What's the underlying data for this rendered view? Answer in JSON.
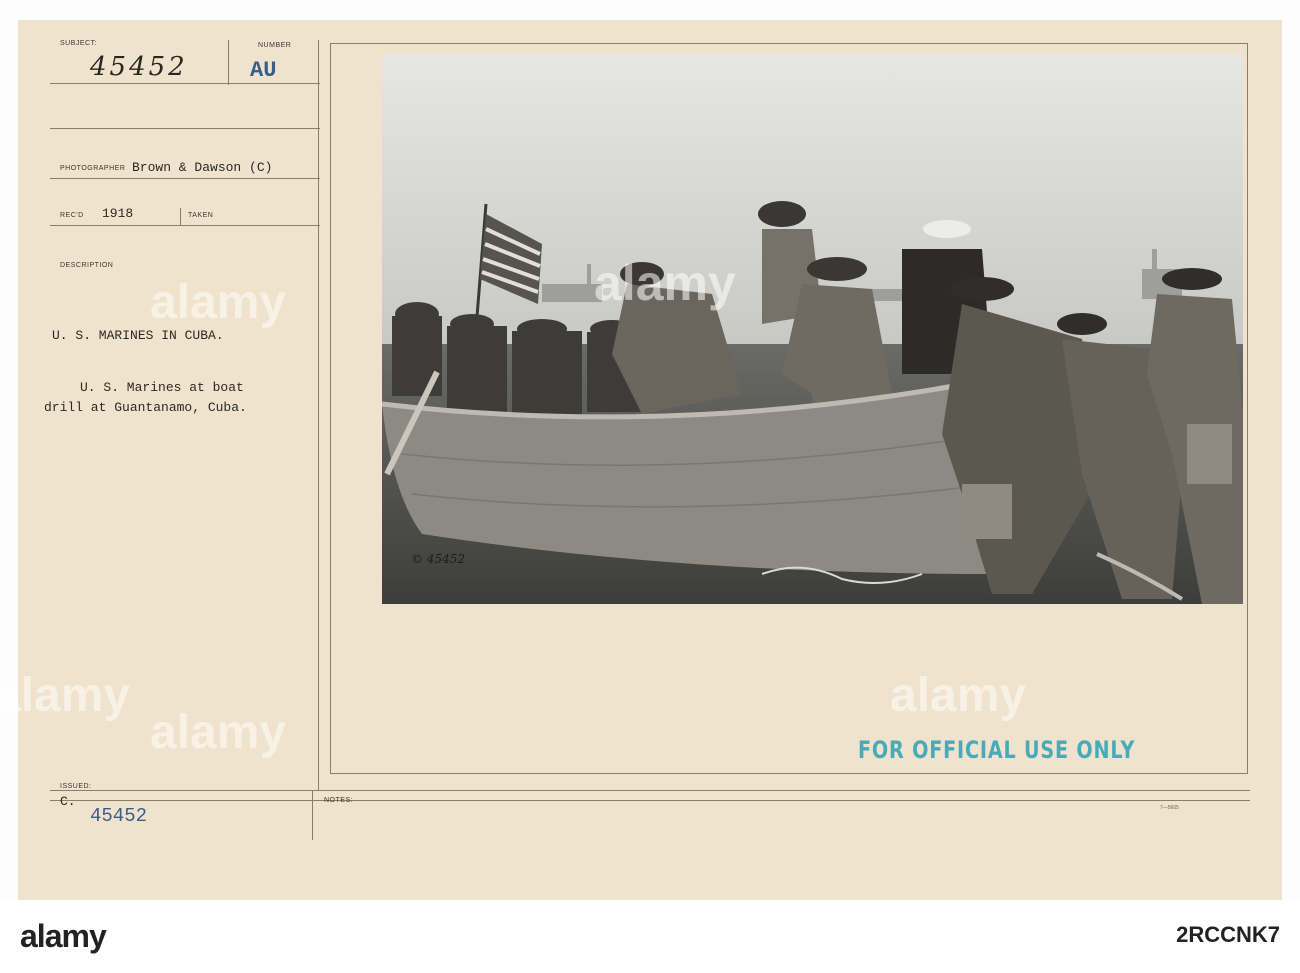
{
  "card": {
    "subject_label": "SUBJECT:",
    "subject_value": "45452",
    "number_label": "NUMBER",
    "number_value": "AU",
    "photographer_label": "PHOTOGRAPHER",
    "photographer_value": "Brown & Dawson (C)",
    "recd_label": "REC'D",
    "recd_value": "1918",
    "taken_label": "TAKEN",
    "description_label": "DESCRIPTION",
    "description_title": "U. S. MARINES IN CUBA.",
    "description_line1": "U. S. Marines at boat",
    "description_line2": "drill at Guantanamo, Cuba.",
    "issued_label": "ISSUED:",
    "issued_prefix": "C.",
    "issued_value": "45452",
    "notes_label": "NOTES:",
    "form_code": "7—5605",
    "stamp_text": "FOR OFFICIAL USE ONLY",
    "negative_number": "© 45452"
  },
  "watermark": {
    "text": "alamy"
  },
  "footer": {
    "logo": "alamy",
    "image_id": "2RCCNK7"
  },
  "colors": {
    "card": "#efe3cd",
    "stamp": "#4aaab9",
    "typed_blue": "#3a5d8a",
    "photo_sky": "#dcdcd9",
    "photo_water": "#4e4e4c"
  }
}
